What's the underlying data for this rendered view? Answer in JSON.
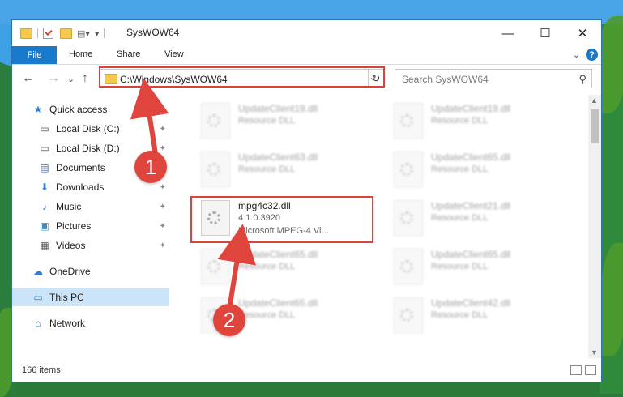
{
  "titlebar": {
    "title": "SysWOW64",
    "minimize": "—",
    "maximize": "☐",
    "close": "✕"
  },
  "ribbon": {
    "file": "File",
    "home": "Home",
    "share": "Share",
    "view": "View",
    "help": "?",
    "expand": "⌄"
  },
  "nav": {
    "back": "←",
    "forward": "→",
    "recent": "⌄",
    "up": "↑"
  },
  "address": {
    "path": "C:\\Windows\\SysWOW64",
    "dropdown": "⌄",
    "refresh": "↻"
  },
  "search": {
    "placeholder": "Search SysWOW64"
  },
  "sidebar": {
    "items": [
      {
        "label": "Quick access",
        "icon": "star-icon",
        "glyph": "★",
        "color": "#2d7cd6",
        "pinned": false
      },
      {
        "label": "Local Disk (C:)",
        "icon": "drive-icon",
        "glyph": "▭",
        "color": "#555",
        "pinned": true
      },
      {
        "label": "Local Disk (D:)",
        "icon": "drive-icon",
        "glyph": "▭",
        "color": "#555",
        "pinned": true
      },
      {
        "label": "Documents",
        "icon": "documents-icon",
        "glyph": "▤",
        "color": "#4a6a9a",
        "pinned": true
      },
      {
        "label": "Downloads",
        "icon": "download-icon",
        "glyph": "⬇",
        "color": "#2d7cd6",
        "pinned": true
      },
      {
        "label": "Music",
        "icon": "music-icon",
        "glyph": "♪",
        "color": "#2d7cd6",
        "pinned": true
      },
      {
        "label": "Pictures",
        "icon": "pictures-icon",
        "glyph": "▣",
        "color": "#3a8ac4",
        "pinned": true
      },
      {
        "label": "Videos",
        "icon": "videos-icon",
        "glyph": "▦",
        "color": "#555",
        "pinned": true
      },
      {
        "label": "OneDrive",
        "icon": "cloud-icon",
        "glyph": "☁",
        "color": "#2d7cd6",
        "pinned": false
      },
      {
        "label": "This PC",
        "icon": "computer-icon",
        "glyph": "▭",
        "color": "#2d7cd6",
        "pinned": false,
        "selected": true
      },
      {
        "label": "Network",
        "icon": "network-icon",
        "glyph": "⌂",
        "color": "#2d7cd6",
        "pinned": false
      }
    ],
    "pin_glyph": "📌"
  },
  "files": [
    {
      "name": "UpdateClient19.dll",
      "desc": "Resource DLL",
      "blurred": true
    },
    {
      "name": "UpdateClient19.dll",
      "desc": "Resource DLL",
      "blurred": true
    },
    {
      "name": "UpdateClient63.dll",
      "desc": "Resource DLL",
      "blurred": true
    },
    {
      "name": "UpdateClient65.dll",
      "desc": "Resource DLL",
      "blurred": true
    },
    {
      "name": "mpg4c32.dll",
      "version": "4.1.0.3920",
      "desc": "Microsoft MPEG-4 Vi...",
      "blurred": false
    },
    {
      "name": "UpdateClient21.dll",
      "desc": "Resource DLL",
      "blurred": true
    },
    {
      "name": "UpdateClient65.dll",
      "desc": "Resource DLL",
      "blurred": true
    },
    {
      "name": "UpdateClient65.dll",
      "desc": "Resource DLL",
      "blurred": true
    },
    {
      "name": "UpdateClient65.dll",
      "desc": "Resource DLL",
      "blurred": true
    },
    {
      "name": "UpdateClient42.dll",
      "desc": "Resource DLL",
      "blurred": true
    }
  ],
  "status": {
    "count": "166 items"
  },
  "annotations": {
    "marker1": "1",
    "marker2": "2",
    "color": "#e0453d"
  }
}
